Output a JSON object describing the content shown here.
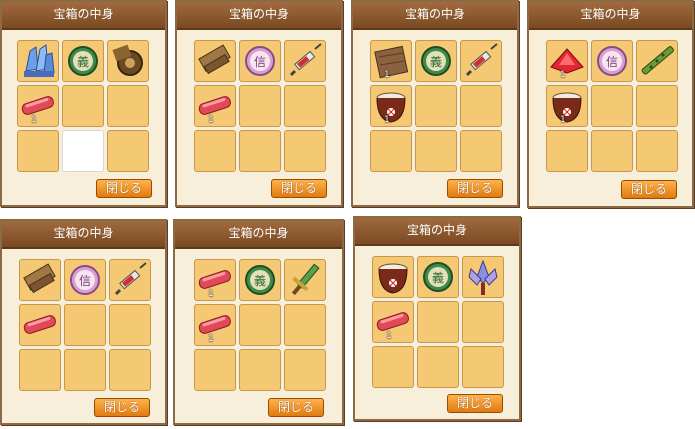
{
  "window_title": "宝箱の中身",
  "close_label": "閉じる",
  "quantity_label": "1",
  "colors": {
    "titlebar": "#8b5a30",
    "slot": "#f5c873",
    "button": "#f08f20"
  },
  "panels": [
    {
      "slots": [
        {
          "icon": "blue-crystal-icon",
          "qty": ""
        },
        {
          "icon": "jade-gi-coin-icon",
          "qty": ""
        },
        {
          "icon": "brown-gear-scrap-icon",
          "qty": ""
        },
        {
          "icon": "red-bar-icon",
          "qty": "1"
        },
        {
          "icon": "",
          "qty": ""
        },
        {
          "icon": "",
          "qty": ""
        },
        {
          "icon": "",
          "qty": ""
        },
        {
          "icon": "white-empty-slot",
          "qty": ""
        },
        {
          "icon": "",
          "qty": ""
        }
      ]
    },
    {
      "slots": [
        {
          "icon": "wooden-plank-icon",
          "qty": ""
        },
        {
          "icon": "pink-shin-coin-icon",
          "qty": ""
        },
        {
          "icon": "syringe-icon",
          "qty": ""
        },
        {
          "icon": "red-bar-icon",
          "qty": "1"
        },
        {
          "icon": "",
          "qty": ""
        },
        {
          "icon": "",
          "qty": ""
        },
        {
          "icon": "",
          "qty": ""
        },
        {
          "icon": "",
          "qty": ""
        },
        {
          "icon": "",
          "qty": ""
        }
      ]
    },
    {
      "slots": [
        {
          "icon": "wood-board-icon",
          "qty": "1"
        },
        {
          "icon": "jade-gi-coin-icon",
          "qty": ""
        },
        {
          "icon": "syringe-icon",
          "qty": ""
        },
        {
          "icon": "rice-pot-icon",
          "qty": "1"
        },
        {
          "icon": "",
          "qty": ""
        },
        {
          "icon": "",
          "qty": ""
        },
        {
          "icon": "",
          "qty": ""
        },
        {
          "icon": "",
          "qty": ""
        },
        {
          "icon": "",
          "qty": ""
        }
      ]
    },
    {
      "slots": [
        {
          "icon": "red-gem-icon",
          "qty": "1"
        },
        {
          "icon": "pink-shin-coin-icon",
          "qty": ""
        },
        {
          "icon": "bamboo-flute-icon",
          "qty": ""
        },
        {
          "icon": "rice-pot-icon",
          "qty": "1"
        },
        {
          "icon": "",
          "qty": ""
        },
        {
          "icon": "",
          "qty": ""
        },
        {
          "icon": "",
          "qty": ""
        },
        {
          "icon": "",
          "qty": ""
        },
        {
          "icon": "",
          "qty": ""
        }
      ]
    },
    {
      "slots": [
        {
          "icon": "wooden-plank-icon",
          "qty": ""
        },
        {
          "icon": "pink-shin-coin-icon",
          "qty": ""
        },
        {
          "icon": "syringe-icon",
          "qty": ""
        },
        {
          "icon": "red-bar-icon",
          "qty": ""
        },
        {
          "icon": "",
          "qty": ""
        },
        {
          "icon": "",
          "qty": ""
        },
        {
          "icon": "",
          "qty": ""
        },
        {
          "icon": "",
          "qty": ""
        },
        {
          "icon": "",
          "qty": ""
        }
      ]
    },
    {
      "slots": [
        {
          "icon": "red-bar-icon",
          "qty": "1"
        },
        {
          "icon": "jade-gi-coin-icon",
          "qty": ""
        },
        {
          "icon": "green-sword-icon",
          "qty": ""
        },
        {
          "icon": "red-bar-icon",
          "qty": "1"
        },
        {
          "icon": "",
          "qty": ""
        },
        {
          "icon": "",
          "qty": ""
        },
        {
          "icon": "",
          "qty": ""
        },
        {
          "icon": "",
          "qty": ""
        },
        {
          "icon": "",
          "qty": ""
        }
      ]
    },
    {
      "slots": [
        {
          "icon": "rice-pot-icon",
          "qty": ""
        },
        {
          "icon": "jade-gi-coin-icon",
          "qty": ""
        },
        {
          "icon": "lotus-ornament-icon",
          "qty": ""
        },
        {
          "icon": "red-bar-icon",
          "qty": "1"
        },
        {
          "icon": "",
          "qty": ""
        },
        {
          "icon": "",
          "qty": ""
        },
        {
          "icon": "",
          "qty": ""
        },
        {
          "icon": "",
          "qty": ""
        },
        {
          "icon": "",
          "qty": ""
        }
      ]
    }
  ]
}
